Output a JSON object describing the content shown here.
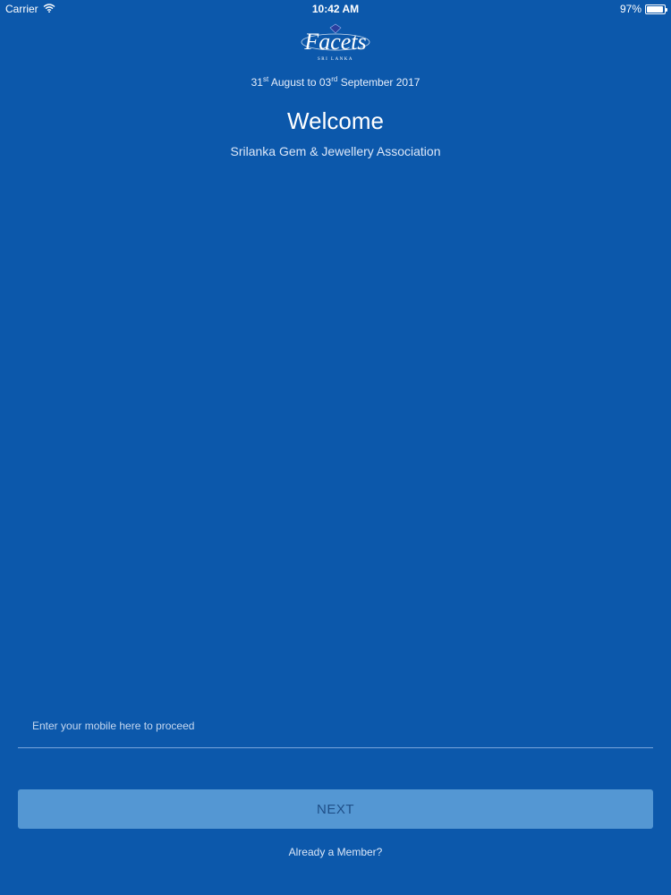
{
  "status_bar": {
    "carrier": "Carrier",
    "time": "10:42 AM",
    "battery": "97%",
    "battery_level": 0.97
  },
  "logo": {
    "text": "Facets",
    "subtext": "SRI LANKA"
  },
  "event": {
    "date_start_day": "31",
    "date_start_suffix": "st",
    "date_middle": " August to 03",
    "date_end_suffix": "rd",
    "date_end": " September 2017"
  },
  "welcome": {
    "title": "Welcome",
    "subtitle": "Srilanka Gem & Jewellery Association"
  },
  "form": {
    "mobile_placeholder": "Enter your mobile here to proceed",
    "mobile_value": "",
    "next_label": "NEXT",
    "member_link": "Already a Member?"
  },
  "colors": {
    "background": "#0c58ab",
    "button": "#5497d3",
    "button_text": "#1f4f88"
  }
}
